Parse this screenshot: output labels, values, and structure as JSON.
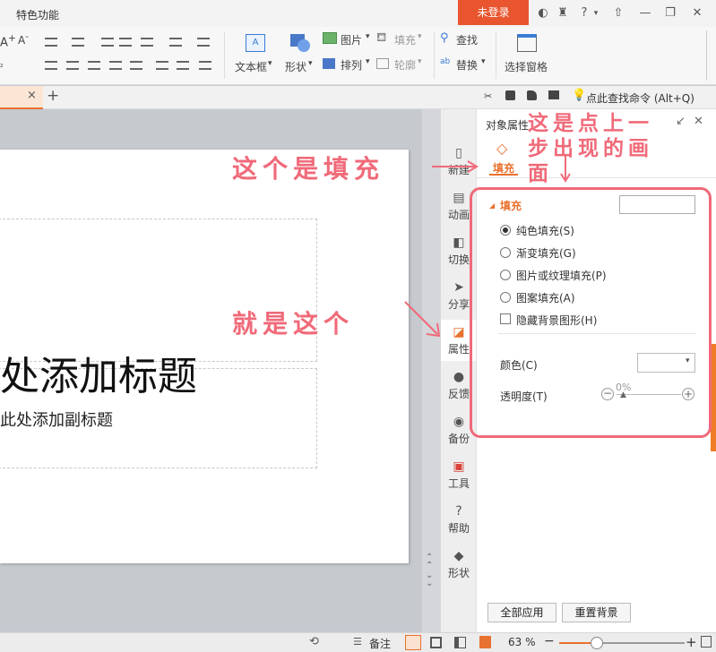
{
  "window": {
    "title": "特色功能",
    "login_label": "未登录",
    "help_label": "?"
  },
  "ribbon": {
    "textbox_label": "文本框",
    "shape_label": "形状",
    "picture_label": "图片",
    "fill_label": "填充",
    "arrange_label": "排列",
    "outline_label": "轮廓",
    "find_label": "查找",
    "replace_label": "替换",
    "selection_pane_label": "选择窗格"
  },
  "command_search": {
    "placeholder": "点此查找命令 (Alt+Q)"
  },
  "tabs": {
    "close_label": "×",
    "new_label": "+"
  },
  "slide": {
    "title_placeholder": "处添加标题",
    "subtitle_placeholder": "此处添加副标题"
  },
  "sidebar": {
    "items": [
      {
        "label": "新建",
        "icon": "file-icon"
      },
      {
        "label": "动画",
        "icon": "animation-icon"
      },
      {
        "label": "切换",
        "icon": "transition-icon"
      },
      {
        "label": "分享",
        "icon": "share-icon"
      },
      {
        "label": "属性",
        "icon": "property-icon"
      },
      {
        "label": "反馈",
        "icon": "feedback-icon"
      },
      {
        "label": "备份",
        "icon": "backup-icon"
      },
      {
        "label": "工具",
        "icon": "toolbox-icon"
      },
      {
        "label": "帮助",
        "icon": "help-icon"
      },
      {
        "label": "形状",
        "icon": "shape-icon"
      }
    ]
  },
  "property_pane": {
    "title": "对象属性",
    "tab_fill": "填充",
    "section_fill": "填充",
    "options": [
      {
        "label": "纯色填充(S)",
        "selected": true
      },
      {
        "label": "渐变填充(G)",
        "selected": false
      },
      {
        "label": "图片或纹理填充(P)",
        "selected": false
      },
      {
        "label": "图案填充(A)",
        "selected": false
      }
    ],
    "hide_background_label": "隐藏背景图形(H)",
    "color_label": "颜色(C)",
    "transparency_label": "透明度(T)",
    "transparency_value": "0%",
    "apply_all_label": "全部应用",
    "reset_label": "重置背景"
  },
  "status_bar": {
    "notes_label": "备注",
    "zoom_value": "63 %"
  },
  "annotations": {
    "fill_note": "这个是填充",
    "this_one": "就是这个",
    "pane_note_line1": "这是点上一",
    "pane_note_line2": "步出现的画",
    "pane_note_line3": "面"
  },
  "colors": {
    "accent": "#e8722f",
    "login_bg": "#e8552f",
    "annotation": "#f06a79"
  }
}
